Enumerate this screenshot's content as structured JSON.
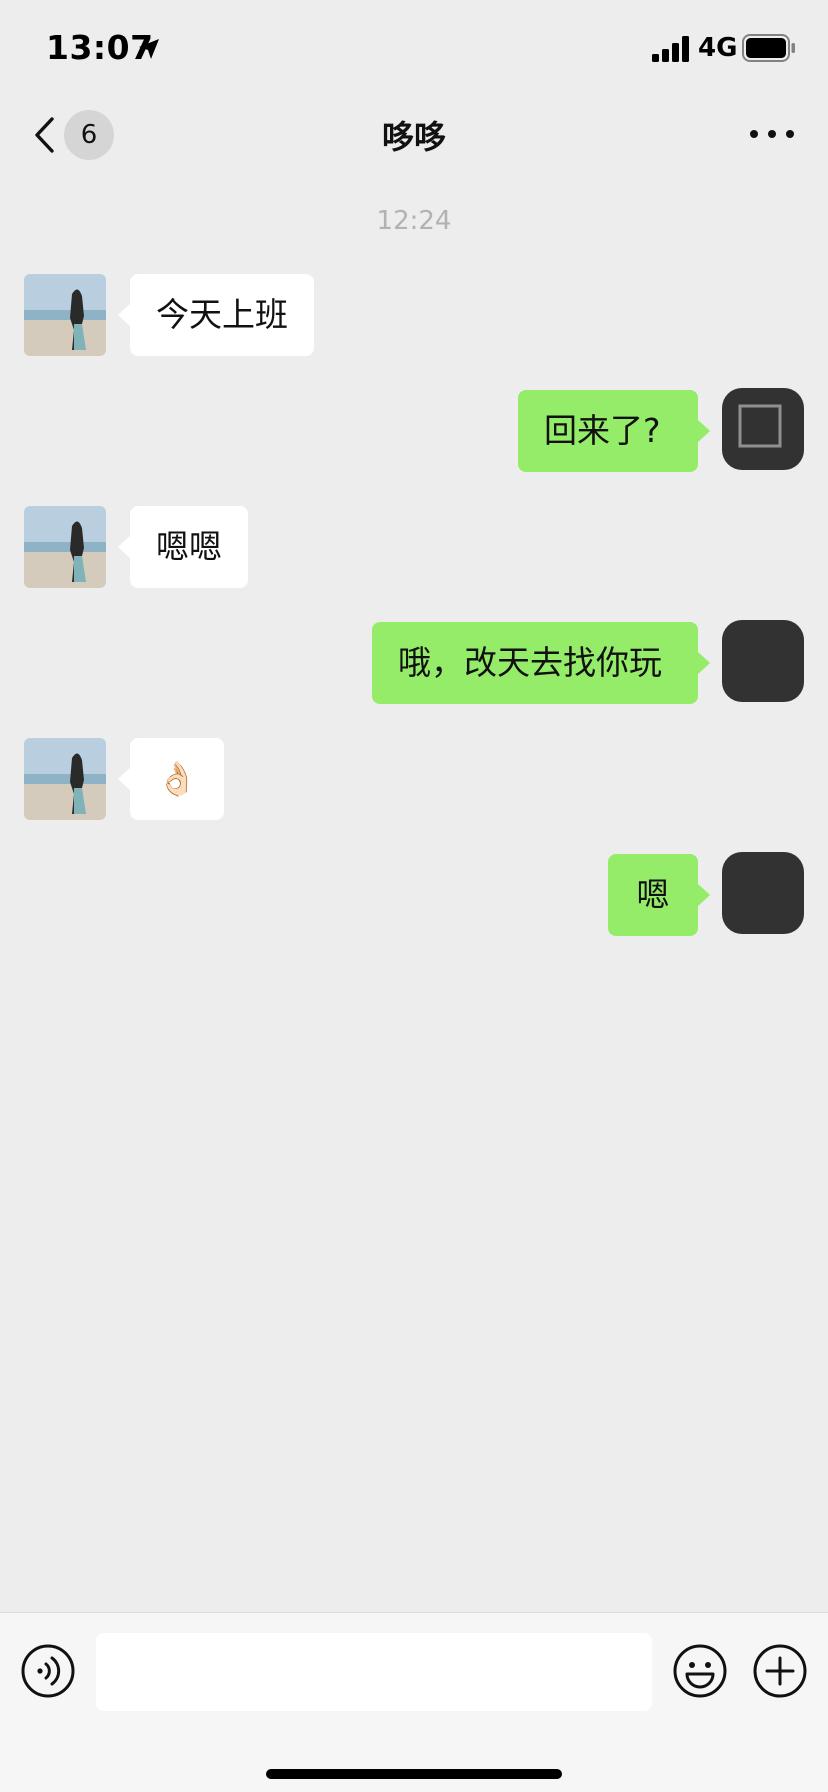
{
  "status_bar": {
    "time": "13:07",
    "network": "4G",
    "icons": [
      "location-arrow-icon",
      "signal-bars-icon",
      "battery-icon"
    ]
  },
  "nav": {
    "unread_count": "6",
    "title": "哆哆",
    "icons": [
      "chevron-left-icon",
      "more-dots-icon"
    ]
  },
  "chat": {
    "timestamp": "12:24",
    "messages": [
      {
        "side": "left",
        "text": "今天上班"
      },
      {
        "side": "right",
        "text": "回来了?"
      },
      {
        "side": "left",
        "text": "嗯嗯"
      },
      {
        "side": "right",
        "text": "哦，改天去找你玩"
      },
      {
        "side": "left",
        "text": "👌🏻"
      },
      {
        "side": "right",
        "text": "嗯"
      }
    ]
  },
  "input_bar": {
    "message_value": "",
    "icons": [
      "voice-icon",
      "emoji-icon",
      "plus-icon"
    ]
  },
  "colors": {
    "background": "#ededed",
    "sent_bubble": "#95ec69",
    "received_bubble": "#ffffff",
    "timestamp_text": "#b2b2b2"
  }
}
